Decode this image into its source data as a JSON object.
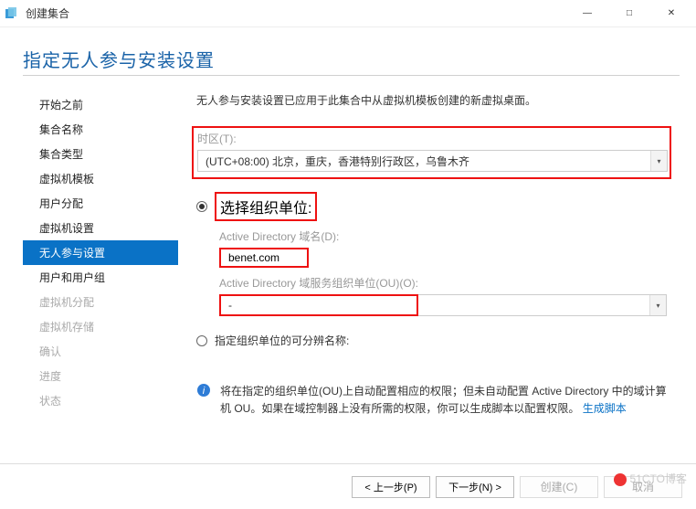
{
  "window": {
    "title": "创建集合",
    "min_icon": "—",
    "max_icon": "□",
    "close_icon": "✕"
  },
  "heading": "指定无人参与安装设置",
  "sidebar": {
    "items": [
      {
        "label": "开始之前",
        "state": "normal"
      },
      {
        "label": "集合名称",
        "state": "normal"
      },
      {
        "label": "集合类型",
        "state": "normal"
      },
      {
        "label": "虚拟机模板",
        "state": "normal"
      },
      {
        "label": "用户分配",
        "state": "normal"
      },
      {
        "label": "虚拟机设置",
        "state": "normal"
      },
      {
        "label": "无人参与设置",
        "state": "active"
      },
      {
        "label": "用户和用户组",
        "state": "normal"
      },
      {
        "label": "虚拟机分配",
        "state": "disabled"
      },
      {
        "label": "虚拟机存储",
        "state": "disabled"
      },
      {
        "label": "确认",
        "state": "disabled"
      },
      {
        "label": "进度",
        "state": "disabled"
      },
      {
        "label": "状态",
        "state": "disabled"
      }
    ]
  },
  "main": {
    "intro": "无人参与安装设置已应用于此集合中从虚拟机模板创建的新虚拟桌面。",
    "timezone_label": "时区(T):",
    "timezone_value": "(UTC+08:00) 北京，重庆，香港特别行政区，乌鲁木齐",
    "radio_select_ou": "选择组织单位:",
    "ad_domain_label": "Active Directory 域名(D):",
    "ad_domain_value": "benet.com",
    "ad_ou_label": "Active Directory 域服务组织单位(OU)(O):",
    "ad_ou_value": "-",
    "radio_specify_dn": "指定组织单位的可分辨名称:",
    "info_text_1": "将在指定的组织单位(OU)上自动配置相应的权限；但未自动配置 Active Directory 中的域计算机 OU。如果在域控制器上没有所需的权限，你可以生成脚本以配置权限。",
    "info_link": "生成脚本"
  },
  "buttons": {
    "prev": "< 上一步(P)",
    "next": "下一步(N) >",
    "create": "创建(C)",
    "cancel": "取消"
  },
  "watermark": "51CTO博客"
}
